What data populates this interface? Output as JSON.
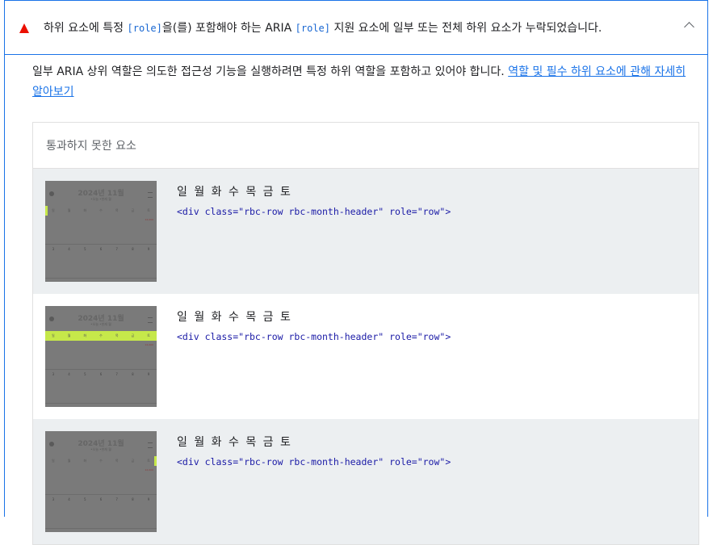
{
  "audit": {
    "title_part1": "하위 요소에 특정 ",
    "title_code1": "[role]",
    "title_part2": "을(를) 포함해야 하는 ARIA ",
    "title_code2": "[role]",
    "title_part3": " 지원 요소에 일부 또는 전체 하위 요소가 누락되었습니다.",
    "description": "일부 ARIA 상위 역할은 의도한 접근성 기능을 실행하려면 특정 하위 역할을 포함하고 있어야 합니다. ",
    "learn_more_link": "역할 및 필수 하위 요소에 관해 자세히 알아보기",
    "status_color": "#eb0f00",
    "accent_color": "#1a73e8"
  },
  "failing_elements": {
    "header": "통과하지 못한 요소",
    "rows": [
      {
        "label": "일 월 화 수 목 금 토",
        "snippet": "<div class=\"rbc-row rbc-month-header\" role=\"row\">",
        "thumbnail": {
          "title": "2024년 11월",
          "subtitle": "•오늘 •현재 월",
          "highlight": "left-edge",
          "days": [
            "일",
            "월",
            "화",
            "수",
            "목",
            "금",
            "토"
          ],
          "nums": [
            "3",
            "4",
            "5",
            "6",
            "7",
            "8",
            "9"
          ],
          "red_note": "12,000"
        }
      },
      {
        "label": "일 월 화 수 목 금 토",
        "snippet": "<div class=\"rbc-row rbc-month-header\" role=\"row\">",
        "thumbnail": {
          "title": "2024년 11월",
          "subtitle": "•오늘 •현재 월",
          "highlight": "full-row",
          "days": [
            "일",
            "월",
            "화",
            "수",
            "목",
            "금",
            "토"
          ],
          "nums": [
            "3",
            "4",
            "5",
            "6",
            "7",
            "8",
            "9"
          ],
          "red_note": "12,000"
        }
      },
      {
        "label": "일 월 화 수 목 금 토",
        "snippet": "<div class=\"rbc-row rbc-month-header\" role=\"row\">",
        "thumbnail": {
          "title": "2024년 11월",
          "subtitle": "•오늘 •현재 월",
          "highlight": "right-edge",
          "days": [
            "일",
            "월",
            "화",
            "수",
            "목",
            "금",
            "토"
          ],
          "nums": [
            "3",
            "4",
            "5",
            "6",
            "7",
            "8",
            "9"
          ],
          "red_note": "12,000"
        }
      }
    ]
  }
}
